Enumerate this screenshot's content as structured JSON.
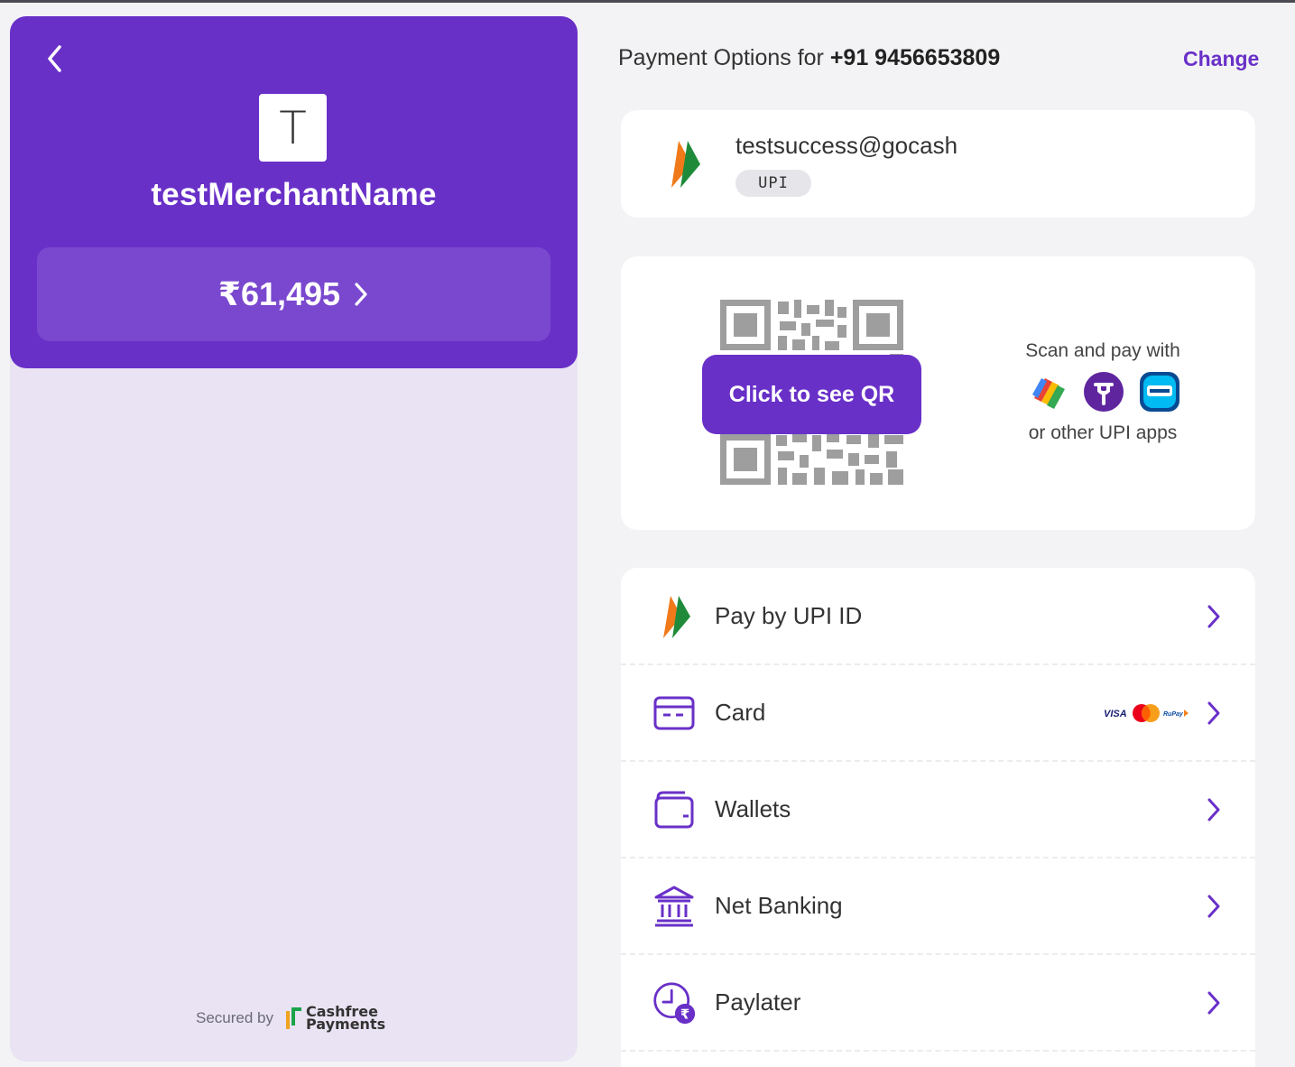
{
  "merchant": {
    "initial": "T",
    "name": "testMerchantName",
    "amount": "₹61,495"
  },
  "footer": {
    "secured_by": "Secured by",
    "brand_line1": "Cashfree",
    "brand_line2": "Payments"
  },
  "header": {
    "prefix": "Payment Options for ",
    "phone": "+91 9456653809",
    "change": "Change"
  },
  "saved_upi": {
    "upi_id": "testsuccess@gocash",
    "badge": "UPI"
  },
  "qr": {
    "button": "Click to see QR",
    "scan_text": "Scan and pay with",
    "other_text": "or other UPI apps",
    "apps": [
      "google-pay-icon",
      "phonepe-icon",
      "paytm-icon"
    ]
  },
  "methods": [
    {
      "label": "Pay by UPI ID",
      "icon": "upi-logo-icon"
    },
    {
      "label": "Card",
      "icon": "card-icon",
      "brands": [
        "VISA",
        "Mastercard",
        "RuPay"
      ]
    },
    {
      "label": "Wallets",
      "icon": "wallet-icon"
    },
    {
      "label": "Net Banking",
      "icon": "bank-icon"
    },
    {
      "label": "Paylater",
      "icon": "paylater-clock-icon"
    }
  ],
  "colors": {
    "brand": "#6930c8",
    "panel_bg": "#e9e3f3",
    "amount_bg": "#7a48cf"
  }
}
